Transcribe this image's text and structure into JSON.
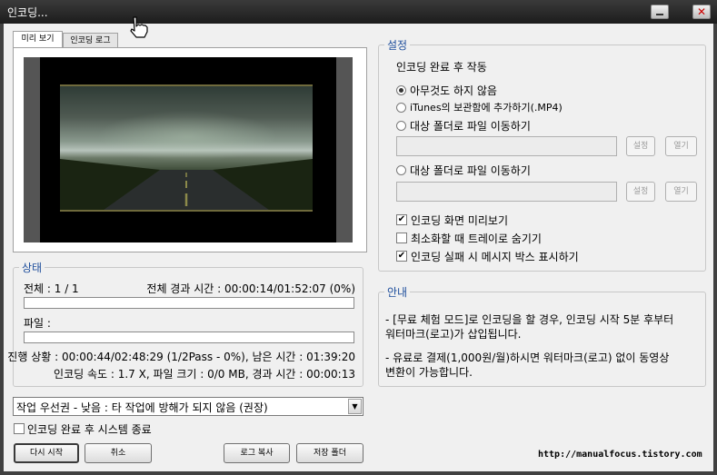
{
  "window": {
    "title": "인코딩...",
    "close_glyph": "✕"
  },
  "tabs": [
    {
      "label": "미리 보기",
      "active": true
    },
    {
      "label": "인코딩 로그",
      "active": false
    }
  ],
  "status": {
    "legend": "상태",
    "total_label": "전체 : 1 / 1",
    "total_elapsed": "전체 경과 시간 : 00:00:14/01:52:07 (0%)",
    "total_progress": 0,
    "file_label": "파일 :",
    "file_progress": 0,
    "progress_detail": "진행 상황 : 00:00:44/02:48:29 (1/2Pass - 0%), 남은 시간 : 01:39:20",
    "speed_detail": "인코딩 속도 : 1.7 X, 파일 크기 : 0/0 MB, 경과 시간 : 00:00:13"
  },
  "priority": {
    "selected": "작업 우선권 - 낮음 : 타 작업에 방해가 되지 않음 (권장)",
    "arrow": "▼"
  },
  "shutdown": {
    "label": "인코딩 완료 후 시스템 종료",
    "checked": false
  },
  "buttons": {
    "restart": "다시 시작",
    "cancel": "취소",
    "copy_log": "로그 복사",
    "save_folder": "저장 폴더"
  },
  "settings": {
    "legend": "설정",
    "after_label": "인코딩 완료 후 작동",
    "radio_nothing": "아무것도 하지 않음",
    "radio_itunes": "iTunes의 보관함에 추가하기(.MP4)",
    "radio_move1": "대상 폴더로 파일 이동하기",
    "radio_move2": "대상 폴더로 파일 이동하기",
    "selected_radio": "radio_nothing",
    "set_button": "설정",
    "open_button": "열기",
    "check_preview": "인코딩 화면 미리보기",
    "check_preview_checked": true,
    "check_tray": "최소화할 때 트레이로 숨기기",
    "check_tray_checked": false,
    "check_failmsg": "인코딩 실패 시 메시지 박스 표시하기",
    "check_failmsg_checked": true
  },
  "notice": {
    "legend": "안내",
    "line1": "- [무료 체험 모드]로 인코딩을 할 경우, 인코딩 시작 5분 후부터",
    "line2": "워터마크(로고)가 삽입됩니다.",
    "line3": "- 유료로 결제(1,000원/월)하시면 워터마크(로고) 없이 동영상",
    "line4": "변환이 가능합니다."
  },
  "footer_url": "http://manualfocus.tistory.com",
  "check_glyph": "✔",
  "colors": {
    "accent_blue": "#1e4e9c",
    "progress_green": "#35a040"
  },
  "icons": {
    "cursor": "hand-pointer-icon",
    "minimize": "minimize-icon",
    "close": "close-icon"
  }
}
